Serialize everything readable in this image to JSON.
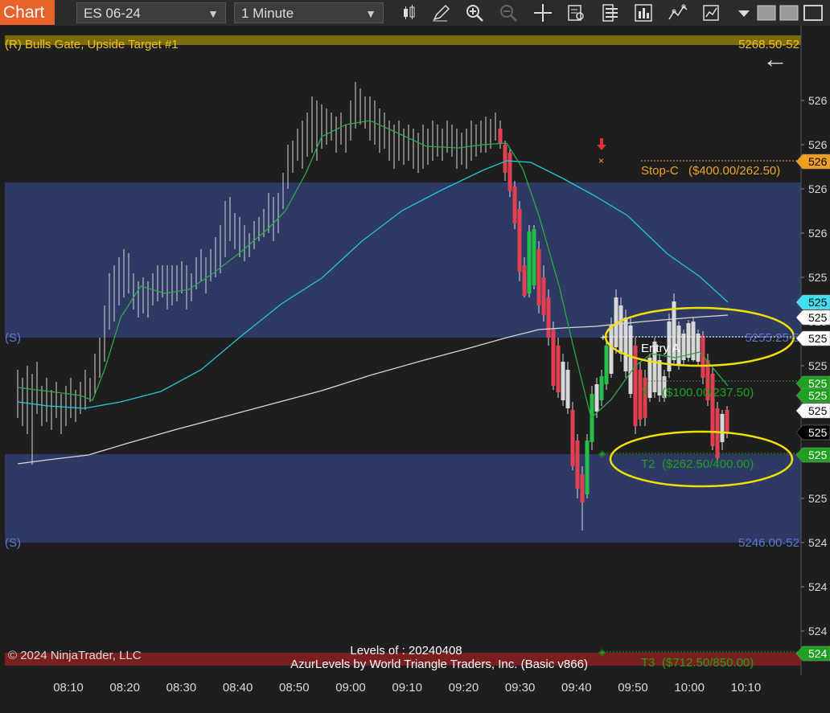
{
  "toolbar": {
    "chart_tab": "Chart",
    "instrument": "ES 06-24",
    "interval": "1 Minute",
    "icons": [
      "bars-type-icon",
      "draw-pencil-icon",
      "zoom-in-icon",
      "zoom-out-icon",
      "crosshair-icon",
      "data-box-icon",
      "properties-icon",
      "strategies-icon",
      "indicators-icon",
      "templates-icon",
      "dropdown-arrow-icon",
      "window-square-icon",
      "window-square-icon",
      "window-square-icon"
    ]
  },
  "chart": {
    "top_label": "(R) Bulls Gate, Upside Target #1",
    "top_price": "5268.50-52",
    "support_label_upper": "(S)",
    "support_price_upper": "5255.25-5",
    "support_label_lower": "(S)",
    "support_price_lower": "5246.00-52",
    "stop_label": "Stop-C",
    "stop_value": "($400.00/262.50)",
    "entry_label": "Entry A",
    "t1_label": "T",
    "t1_value": "($100.00/237.50)",
    "t2_label": "T2",
    "t2_value": "($262.50/400.00)",
    "t3_label": "T3",
    "t3_value": "($712.50/850.00)",
    "copyright": "© 2024 NinjaTrader, LLC",
    "levels_of": "Levels of : 20240408",
    "azur": "AzurLevels by World Triangle Traders, Inc. (Basic v866)",
    "back_arrow": "←"
  },
  "price_axis": {
    "labels": [
      "526",
      "526",
      "526",
      "526",
      "525",
      "525",
      "525",
      "525",
      "525",
      "525",
      "524",
      "524",
      "524",
      "524"
    ],
    "flags": [
      {
        "text": "526",
        "color": "#f0a020",
        "fg": "#000"
      },
      {
        "text": "525",
        "color": "#40e0f0",
        "fg": "#000"
      },
      {
        "text": "525",
        "color": "#ffffff",
        "fg": "#000"
      },
      {
        "text": "525",
        "color": "#ffffff",
        "fg": "#000"
      },
      {
        "text": "525",
        "color": "#1fa01f",
        "fg": "#fff"
      },
      {
        "text": "525",
        "color": "#1fa01f",
        "fg": "#fff"
      },
      {
        "text": "525",
        "color": "#ffffff",
        "fg": "#000"
      },
      {
        "text": "525",
        "color": "#000000",
        "fg": "#fff"
      },
      {
        "text": "525",
        "color": "#1fa01f",
        "fg": "#fff"
      },
      {
        "text": "524",
        "color": "#1fa01f",
        "fg": "#fff"
      }
    ]
  },
  "time_axis": [
    "08:10",
    "08:20",
    "08:30",
    "08:40",
    "08:50",
    "09:00",
    "09:10",
    "09:20",
    "09:30",
    "09:40",
    "09:50",
    "10:00",
    "10:10"
  ]
}
